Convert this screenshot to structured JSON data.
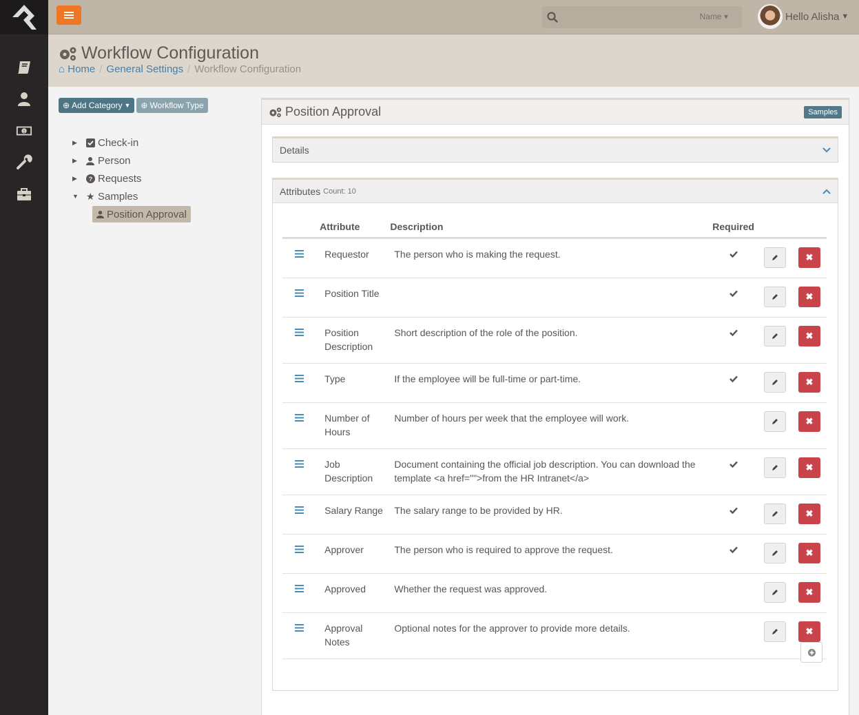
{
  "topbar": {
    "search_filter": "Name",
    "greeting": "Hello Alisha"
  },
  "header": {
    "title": "Workflow Configuration",
    "breadcrumb": [
      {
        "label": "Home"
      },
      {
        "label": "General Settings"
      },
      {
        "label": "Workflow Configuration"
      }
    ]
  },
  "sidebar": {
    "items": [
      {
        "icon": "book-icon"
      },
      {
        "icon": "person-icon"
      },
      {
        "icon": "money-icon"
      },
      {
        "icon": "wrench-icon"
      },
      {
        "icon": "briefcase-icon"
      }
    ]
  },
  "left": {
    "add_category": "Add Category",
    "workflow_type": "Workflow Type",
    "tree": [
      {
        "label": "Check-in",
        "icon": "checkbox-icon",
        "expanded": false
      },
      {
        "label": "Person",
        "icon": "user-icon",
        "expanded": false
      },
      {
        "label": "Requests",
        "icon": "question-icon",
        "expanded": false
      },
      {
        "label": "Samples",
        "icon": "star-icon",
        "expanded": true
      }
    ],
    "selected_child": "Position Approval"
  },
  "panel": {
    "title": "Position Approval",
    "badge": "Samples",
    "details_label": "Details",
    "attributes_label": "Attributes",
    "attributes_count": "Count: 10",
    "columns": {
      "attribute": "Attribute",
      "description": "Description",
      "required": "Required"
    },
    "rows": [
      {
        "attribute": "Requestor",
        "description": "The person who is making the request.",
        "required": true
      },
      {
        "attribute": "Position Title",
        "description": "",
        "required": true
      },
      {
        "attribute": "Position Description",
        "description": "Short description of the role of the position.",
        "required": true
      },
      {
        "attribute": "Type",
        "description": "If the employee will be full-time or part-time.",
        "required": true
      },
      {
        "attribute": "Number of Hours",
        "description": "Number of hours per week that the employee will work.",
        "required": false
      },
      {
        "attribute": "Job Description",
        "description": "Document containing the official job description. You can download the template <a href=\"\">from the HR Intranet</a>",
        "required": true
      },
      {
        "attribute": "Salary Range",
        "description": "The salary range to be provided by HR.",
        "required": true
      },
      {
        "attribute": "Approver",
        "description": "The person who is required to approve the request.",
        "required": true
      },
      {
        "attribute": "Approved",
        "description": "Whether the request was approved.",
        "required": false
      },
      {
        "attribute": "Approval Notes",
        "description": "Optional notes for the approver to provide more details.",
        "required": false
      }
    ]
  },
  "colors": {
    "accent_orange": "#ee7625",
    "link_blue": "#4a7fa7",
    "danger_red": "#c9444a",
    "badge_teal": "#527989"
  }
}
